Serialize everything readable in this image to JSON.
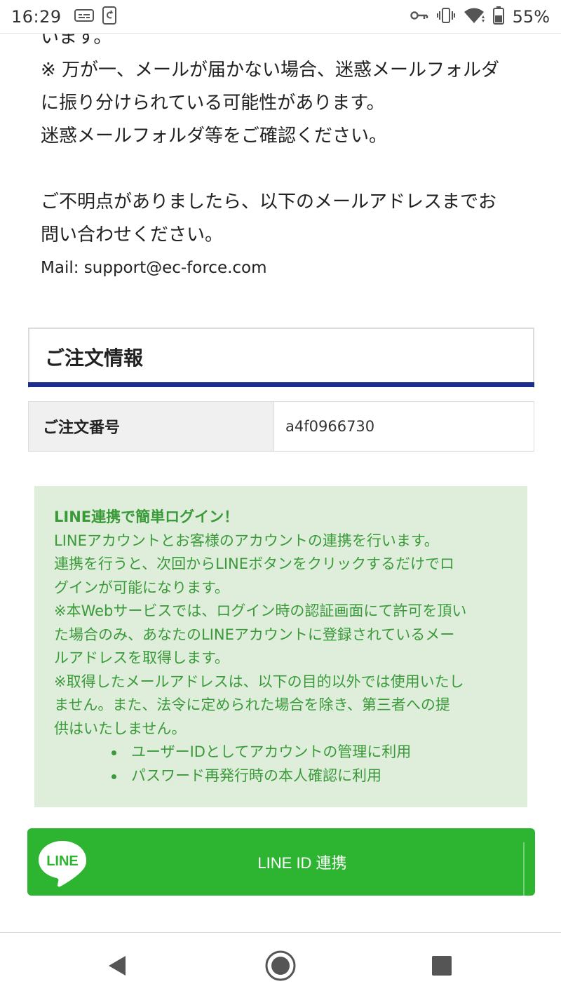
{
  "status_bar": {
    "time": "16:29",
    "battery_percent": "55%",
    "icons": [
      "caption-icon",
      "sync-app-icon",
      "vpn-key-icon",
      "vibrate-icon",
      "wifi-icon",
      "battery-icon"
    ]
  },
  "intro": {
    "lines": [
      "います。",
      "※ 万が一、メールが届かない場合、迷惑メールフォルダ",
      "に振り分けられている可能性があります。",
      "迷惑メールフォルダ等をご確認ください。",
      "ご不明点がありましたら、以下のメールアドレスまでお",
      "問い合わせください。"
    ],
    "mail_line": "Mail: support@ec-force.com"
  },
  "order_info": {
    "title": "ご注文情報",
    "accent_color": "#1b2d8f",
    "rows": [
      {
        "label": "ご注文番号",
        "value": "a4f0966730"
      }
    ]
  },
  "line_info": {
    "title": "LINE連携で簡単ログイン！",
    "paragraph_lines": [
      "LINEアカウントとお客様のアカウントの連携を行います。",
      "連携を行うと、次回からLINEボタンをクリックするだけでロ",
      "グインが可能になります。",
      "※本Webサービスでは、ログイン時の認証画面にて許可を頂い",
      "た場合のみ、あなたのLINEアカウントに登録されているメー",
      "ルアドレスを取得します。",
      "※取得したメールアドレスは、以下の目的以外では使用いたし",
      "ません。また、法令に定められた場合を除き、第三者への提",
      "供はいたしません。"
    ],
    "bullets": [
      "ユーザーIDとしてアカウントの管理に利用",
      "パスワード再発行時の本人確認に利用"
    ],
    "text_color": "#3a9a3a",
    "background": "#dfeedb"
  },
  "line_button": {
    "label": "LINE ID 連携",
    "logo_text": "LINE",
    "color": "#2db431"
  },
  "nav": {
    "icons": [
      "back-icon",
      "home-icon",
      "recents-icon"
    ]
  }
}
